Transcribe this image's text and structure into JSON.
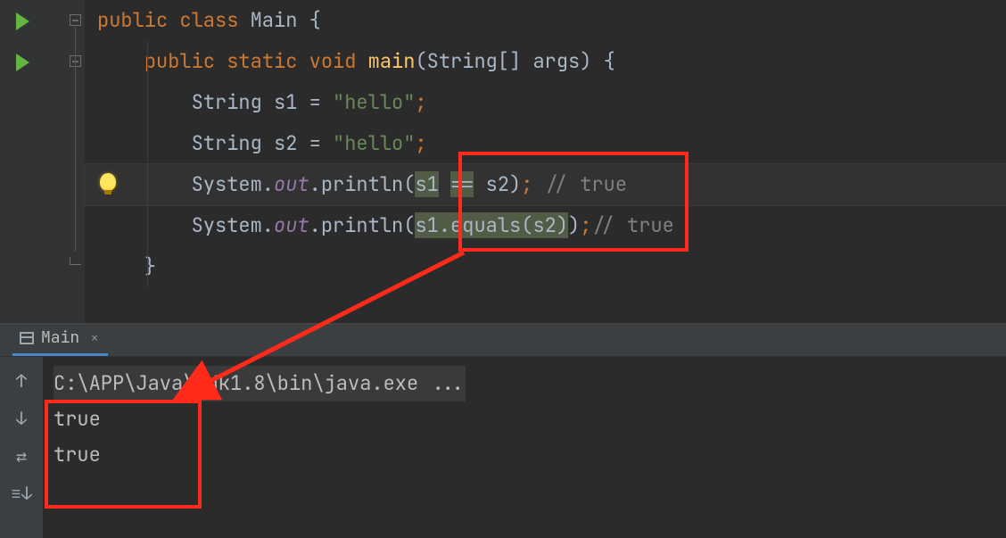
{
  "editor": {
    "lines": [
      {
        "tokens": [
          {
            "cls": "kw",
            "t": "public class "
          },
          {
            "cls": "id",
            "t": "Main {"
          }
        ]
      },
      {
        "indent": "    ",
        "tokens": [
          {
            "cls": "kw",
            "t": "public static void "
          },
          {
            "cls": "fn",
            "t": "main"
          },
          {
            "cls": "id",
            "t": "(String[] args) {"
          }
        ]
      },
      {
        "indent": "        ",
        "tokens": [
          {
            "cls": "id",
            "t": "String s1 = "
          },
          {
            "cls": "str",
            "t": "\"hello\""
          },
          {
            "cls": "kw",
            "t": ";"
          }
        ]
      },
      {
        "indent": "        ",
        "tokens": [
          {
            "cls": "id",
            "t": "String s2 = "
          },
          {
            "cls": "str",
            "t": "\"hello\""
          },
          {
            "cls": "kw",
            "t": ";"
          }
        ]
      },
      {
        "indent": "        ",
        "current": true,
        "tokens": [
          {
            "cls": "id",
            "t": "System."
          },
          {
            "cls": "fld",
            "t": "out"
          },
          {
            "cls": "id",
            "t": ".println("
          },
          {
            "cls": "sel-bg",
            "t": "s1"
          },
          {
            "cls": "id",
            "t": " "
          },
          {
            "cls": "op-sel",
            "t": "=="
          },
          {
            "cls": "id",
            "t": " s2)"
          },
          {
            "cls": "kw",
            "t": "; "
          },
          {
            "cls": "cmt",
            "t": "// true"
          }
        ]
      },
      {
        "indent": "        ",
        "tokens": [
          {
            "cls": "id",
            "t": "System."
          },
          {
            "cls": "fld",
            "t": "out"
          },
          {
            "cls": "id",
            "t": ".println("
          },
          {
            "cls": "sel-bg",
            "t": "s1.equals(s2)"
          },
          {
            "cls": "id",
            "t": ")"
          },
          {
            "cls": "kw",
            "t": ";"
          },
          {
            "cls": "cmt",
            "t": "// true"
          }
        ]
      },
      {
        "indent": "    ",
        "tokens": [
          {
            "cls": "id",
            "t": "}"
          }
        ]
      }
    ]
  },
  "console": {
    "tab_label": "Main",
    "cmd": "C:\\APP\\Java\\jdk1.8\\bin\\java.exe ...",
    "output": [
      "true",
      "true"
    ]
  },
  "icons": {
    "up": "↑",
    "down": "↓",
    "wrap": "⇄",
    "step": "≡↓"
  }
}
